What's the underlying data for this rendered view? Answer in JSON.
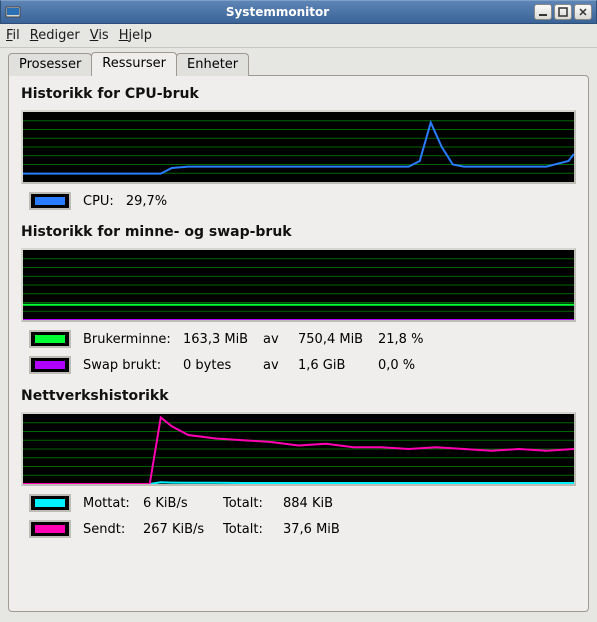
{
  "window": {
    "title": "Systemmonitor"
  },
  "menu": {
    "file": "Fil",
    "edit": "Rediger",
    "view": "Vis",
    "help": "Hjelp"
  },
  "tabs": {
    "processes": "Prosesser",
    "resources": "Ressurser",
    "devices": "Enheter"
  },
  "cpu": {
    "title": "Historikk for CPU-bruk",
    "label": "CPU:",
    "value": "29,7%",
    "color": "#2a7cff"
  },
  "mem": {
    "title": "Historikk for minne- og swap-bruk",
    "user_label": "Brukerminne:",
    "user_used": "163,3 MiB",
    "of": "av",
    "user_total": "750,4 MiB",
    "user_pct": "21,8 %",
    "user_color": "#00ff33",
    "swap_label": "Swap brukt:",
    "swap_used": "0 bytes",
    "swap_total": "1,6 GiB",
    "swap_pct": "0,0 %",
    "swap_color": "#b200ff"
  },
  "net": {
    "title": "Nettverkshistorikk",
    "recv_label": "Mottat:",
    "recv_rate": "6 KiB/s",
    "total_label": "Totalt:",
    "recv_total": "884 KiB",
    "recv_color": "#00f0ff",
    "send_label": "Sendt:",
    "send_rate": "267 KiB/s",
    "send_total": "37,6 MiB",
    "send_color": "#ff00b3"
  },
  "chart_data": [
    {
      "type": "line",
      "title": "Historikk for CPU-bruk",
      "xlabel": "",
      "ylabel": "",
      "ylim": [
        0,
        100
      ],
      "x": [
        0,
        5,
        10,
        15,
        20,
        25,
        27,
        30,
        35,
        40,
        45,
        50,
        55,
        60,
        65,
        70,
        72,
        74,
        76,
        78,
        80,
        85,
        90,
        95,
        99,
        100
      ],
      "series": [
        {
          "name": "CPU",
          "color": "#2a7cff",
          "values": [
            12,
            12,
            12,
            12,
            12,
            12,
            20,
            22,
            22,
            22,
            22,
            22,
            22,
            22,
            22,
            22,
            30,
            85,
            50,
            25,
            22,
            22,
            22,
            22,
            30,
            40
          ]
        }
      ]
    },
    {
      "type": "line",
      "title": "Historikk for minne- og swap-bruk",
      "xlabel": "",
      "ylabel": "",
      "ylim": [
        0,
        100
      ],
      "x": [
        0,
        100
      ],
      "series": [
        {
          "name": "Brukerminne",
          "color": "#00ff33",
          "values": [
            21.8,
            21.8
          ]
        },
        {
          "name": "Swap",
          "color": "#b200ff",
          "values": [
            0,
            0
          ]
        }
      ]
    },
    {
      "type": "line",
      "title": "Nettverkshistorikk",
      "xlabel": "",
      "ylabel": "",
      "ylim": [
        0,
        400
      ],
      "x": [
        0,
        5,
        10,
        15,
        20,
        23,
        25,
        27,
        30,
        35,
        40,
        45,
        50,
        55,
        60,
        65,
        70,
        75,
        80,
        85,
        90,
        95,
        100
      ],
      "series": [
        {
          "name": "Mottat",
          "color": "#00f0ff",
          "values": [
            0,
            0,
            0,
            0,
            0,
            0,
            10,
            8,
            7,
            7,
            6,
            6,
            6,
            6,
            6,
            6,
            6,
            6,
            6,
            6,
            6,
            6,
            6
          ]
        },
        {
          "name": "Sendt",
          "color": "#ff00b3",
          "values": [
            0,
            0,
            0,
            0,
            0,
            0,
            380,
            330,
            280,
            260,
            250,
            240,
            220,
            230,
            210,
            210,
            200,
            210,
            200,
            190,
            200,
            190,
            200
          ]
        }
      ]
    }
  ]
}
